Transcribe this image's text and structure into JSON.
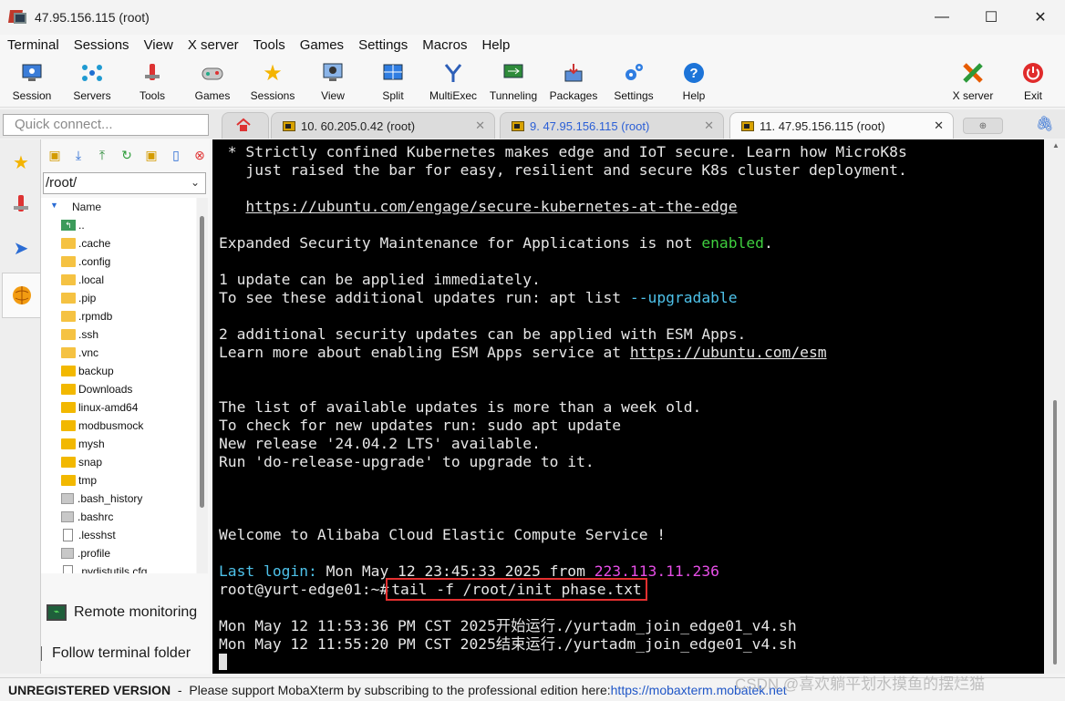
{
  "window": {
    "title": "47.95.156.115 (root)"
  },
  "window_controls": {
    "minimize": "—",
    "maximize": "☐",
    "close": "✕"
  },
  "menu": [
    "Terminal",
    "Sessions",
    "View",
    "X server",
    "Tools",
    "Games",
    "Settings",
    "Macros",
    "Help"
  ],
  "toolbar": {
    "items": [
      {
        "label": "Session",
        "icon": "session-icon"
      },
      {
        "label": "Servers",
        "icon": "servers-icon"
      },
      {
        "label": "Tools",
        "icon": "tools-icon"
      },
      {
        "label": "Games",
        "icon": "games-icon"
      },
      {
        "label": "Sessions",
        "icon": "sessions-star-icon"
      },
      {
        "label": "View",
        "icon": "view-icon"
      },
      {
        "label": "Split",
        "icon": "split-icon"
      },
      {
        "label": "MultiExec",
        "icon": "multiexec-icon"
      },
      {
        "label": "Tunneling",
        "icon": "tunneling-icon"
      },
      {
        "label": "Packages",
        "icon": "packages-icon"
      },
      {
        "label": "Settings",
        "icon": "settings-icon"
      },
      {
        "label": "Help",
        "icon": "help-icon"
      }
    ],
    "xserver": "X server",
    "exit": "Exit"
  },
  "quick_connect": {
    "placeholder": "Quick connect..."
  },
  "tabs": [
    {
      "label": "10. 60.205.0.42 (root)",
      "active": false
    },
    {
      "label": "9. 47.95.156.115 (root)",
      "active": false,
      "color": "#2b5fd6"
    },
    {
      "label": "11. 47.95.156.115 (root)",
      "active": true
    }
  ],
  "sftp": {
    "path": "/root/",
    "column": "Name",
    "files": [
      {
        "name": "..",
        "type": "up"
      },
      {
        "name": ".cache",
        "type": "folder"
      },
      {
        "name": ".config",
        "type": "folder"
      },
      {
        "name": ".local",
        "type": "folder"
      },
      {
        "name": ".pip",
        "type": "folder"
      },
      {
        "name": ".rpmdb",
        "type": "folder"
      },
      {
        "name": ".ssh",
        "type": "folder"
      },
      {
        "name": ".vnc",
        "type": "folder"
      },
      {
        "name": "backup",
        "type": "folder"
      },
      {
        "name": "Downloads",
        "type": "folder"
      },
      {
        "name": "linux-amd64",
        "type": "folder"
      },
      {
        "name": "modbusmock",
        "type": "folder"
      },
      {
        "name": "mysh",
        "type": "folder"
      },
      {
        "name": "snap",
        "type": "folder"
      },
      {
        "name": "tmp",
        "type": "folder"
      },
      {
        "name": ".bash_history",
        "type": "file"
      },
      {
        "name": ".bashrc",
        "type": "file"
      },
      {
        "name": ".lesshst",
        "type": "doc"
      },
      {
        "name": ".profile",
        "type": "file"
      },
      {
        "name": ".pydistutils.cfg",
        "type": "doc"
      }
    ],
    "remote_monitoring": "Remote monitoring",
    "follow_folder": "Follow terminal folder"
  },
  "terminal": {
    "l1": " * Strictly confined Kubernetes makes edge and IoT secure. Learn how MicroK8s",
    "l2": "   just raised the bar for easy, resilient and secure K8s cluster deployment.",
    "l3_url": "https://ubuntu.com/engage/secure-kubernetes-at-the-edge",
    "l4a": "Expanded Security Maintenance for Applications is not ",
    "l4b": "enabled",
    "l4c": ".",
    "l5": "1 update can be applied immediately.",
    "l6a": "To see these additional updates run: apt list ",
    "l6b": "--upgradable",
    "l7": "2 additional security updates can be applied with ESM Apps.",
    "l8a": "Learn more about enabling ESM Apps service at ",
    "l8b": "https://ubuntu.com/esm",
    "l9": "The list of available updates is more than a week old.",
    "l10": "To check for new updates run: sudo apt update",
    "l11": "New release '24.04.2 LTS' available.",
    "l12": "Run 'do-release-upgrade' to upgrade to it.",
    "l13": "Welcome to Alibaba Cloud Elastic Compute Service !",
    "l14a": "Last login:",
    "l14b": " Mon May 12 23:45:33 2025 from ",
    "l14c": "223.113.11.236",
    "prompt": "root@yurt-edge01:~#",
    "command": "tail -f /root/init phase.txt",
    "out1": "Mon May 12 11:53:36 PM CST 2025开始运行./yurtadm_join_edge01_v4.sh",
    "out2": "Mon May 12 11:55:20 PM CST 2025结束运行./yurtadm_join_edge01_v4.sh"
  },
  "status": {
    "unregistered": "UNREGISTERED VERSION",
    "sep": "  -  ",
    "message": "Please support MobaXterm by subscribing to the professional edition here: ",
    "link": "https://mobaxterm.mobatek.net"
  },
  "watermark": "CSDN @喜欢躺平划水摸鱼的摆烂猫"
}
